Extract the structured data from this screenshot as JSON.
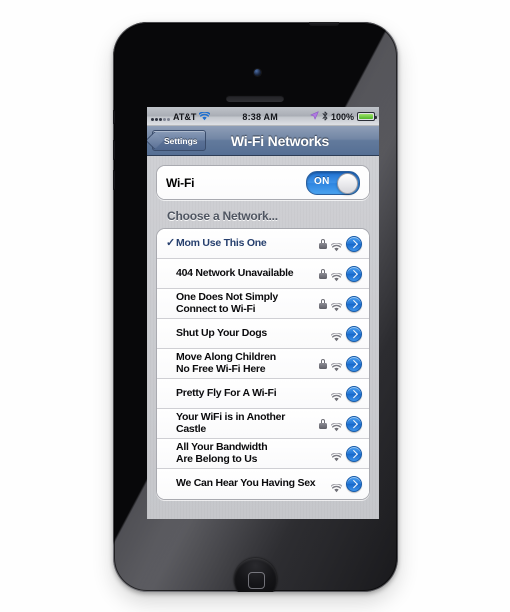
{
  "device": {
    "name": "iphone-5-black",
    "camera_label": "front-camera",
    "earpiece_label": "earpiece-speaker",
    "home_button_label": "Home"
  },
  "status_bar": {
    "carrier": "AT&T",
    "time": "8:38 AM",
    "battery_percent": "100%",
    "signal_icon": "signal-dots-icon",
    "wifi_icon": "wifi-icon",
    "location_icon": "location-arrow-icon",
    "bluetooth_icon": "bluetooth-icon",
    "battery_icon": "battery-full-icon",
    "signal_bars_filled": 3,
    "signal_bars_total": 5
  },
  "nav_bar": {
    "back_label": "Settings",
    "title": "Wi-Fi Networks",
    "back_icon": "chevron-left-icon"
  },
  "wifi_section": {
    "label": "Wi-Fi",
    "toggle_state": "ON",
    "toggle_on": true
  },
  "networks_section": {
    "header": "Choose a Network...",
    "rows": [
      {
        "name": "Mom Use This One",
        "selected": true,
        "locked": true,
        "checkmark": "✓",
        "disclosure_icon": "disclosure-chevron-icon"
      },
      {
        "name": "404 Network Unavailable",
        "selected": false,
        "locked": true,
        "checkmark": "",
        "disclosure_icon": "disclosure-chevron-icon"
      },
      {
        "name": "One Does Not Simply\nConnect to Wi-Fi",
        "selected": false,
        "locked": true,
        "checkmark": "",
        "disclosure_icon": "disclosure-chevron-icon"
      },
      {
        "name": "Shut Up Your Dogs",
        "selected": false,
        "locked": false,
        "checkmark": "",
        "disclosure_icon": "disclosure-chevron-icon"
      },
      {
        "name": "Move Along Children\nNo Free Wi-Fi Here",
        "selected": false,
        "locked": true,
        "checkmark": "",
        "disclosure_icon": "disclosure-chevron-icon"
      },
      {
        "name": "Pretty Fly For A Wi-Fi",
        "selected": false,
        "locked": false,
        "checkmark": "",
        "disclosure_icon": "disclosure-chevron-icon"
      },
      {
        "name": "Your WiFi is in Another\nCastle",
        "selected": false,
        "locked": true,
        "checkmark": "",
        "disclosure_icon": "disclosure-chevron-icon"
      },
      {
        "name": "All Your Bandwidth\nAre Belong to Us",
        "selected": false,
        "locked": false,
        "checkmark": "",
        "disclosure_icon": "disclosure-chevron-icon"
      },
      {
        "name": "We Can Hear You Having Sex",
        "selected": false,
        "locked": false,
        "checkmark": "",
        "disclosure_icon": "disclosure-chevron-icon"
      }
    ]
  },
  "colors": {
    "accent_blue": "#1f73d4",
    "selected_text": "#27406e",
    "nav_bar": "#627a9c",
    "toggle_on": "#2f85e0",
    "battery_green": "#4fb52a",
    "page_background": "#fefefe"
  }
}
